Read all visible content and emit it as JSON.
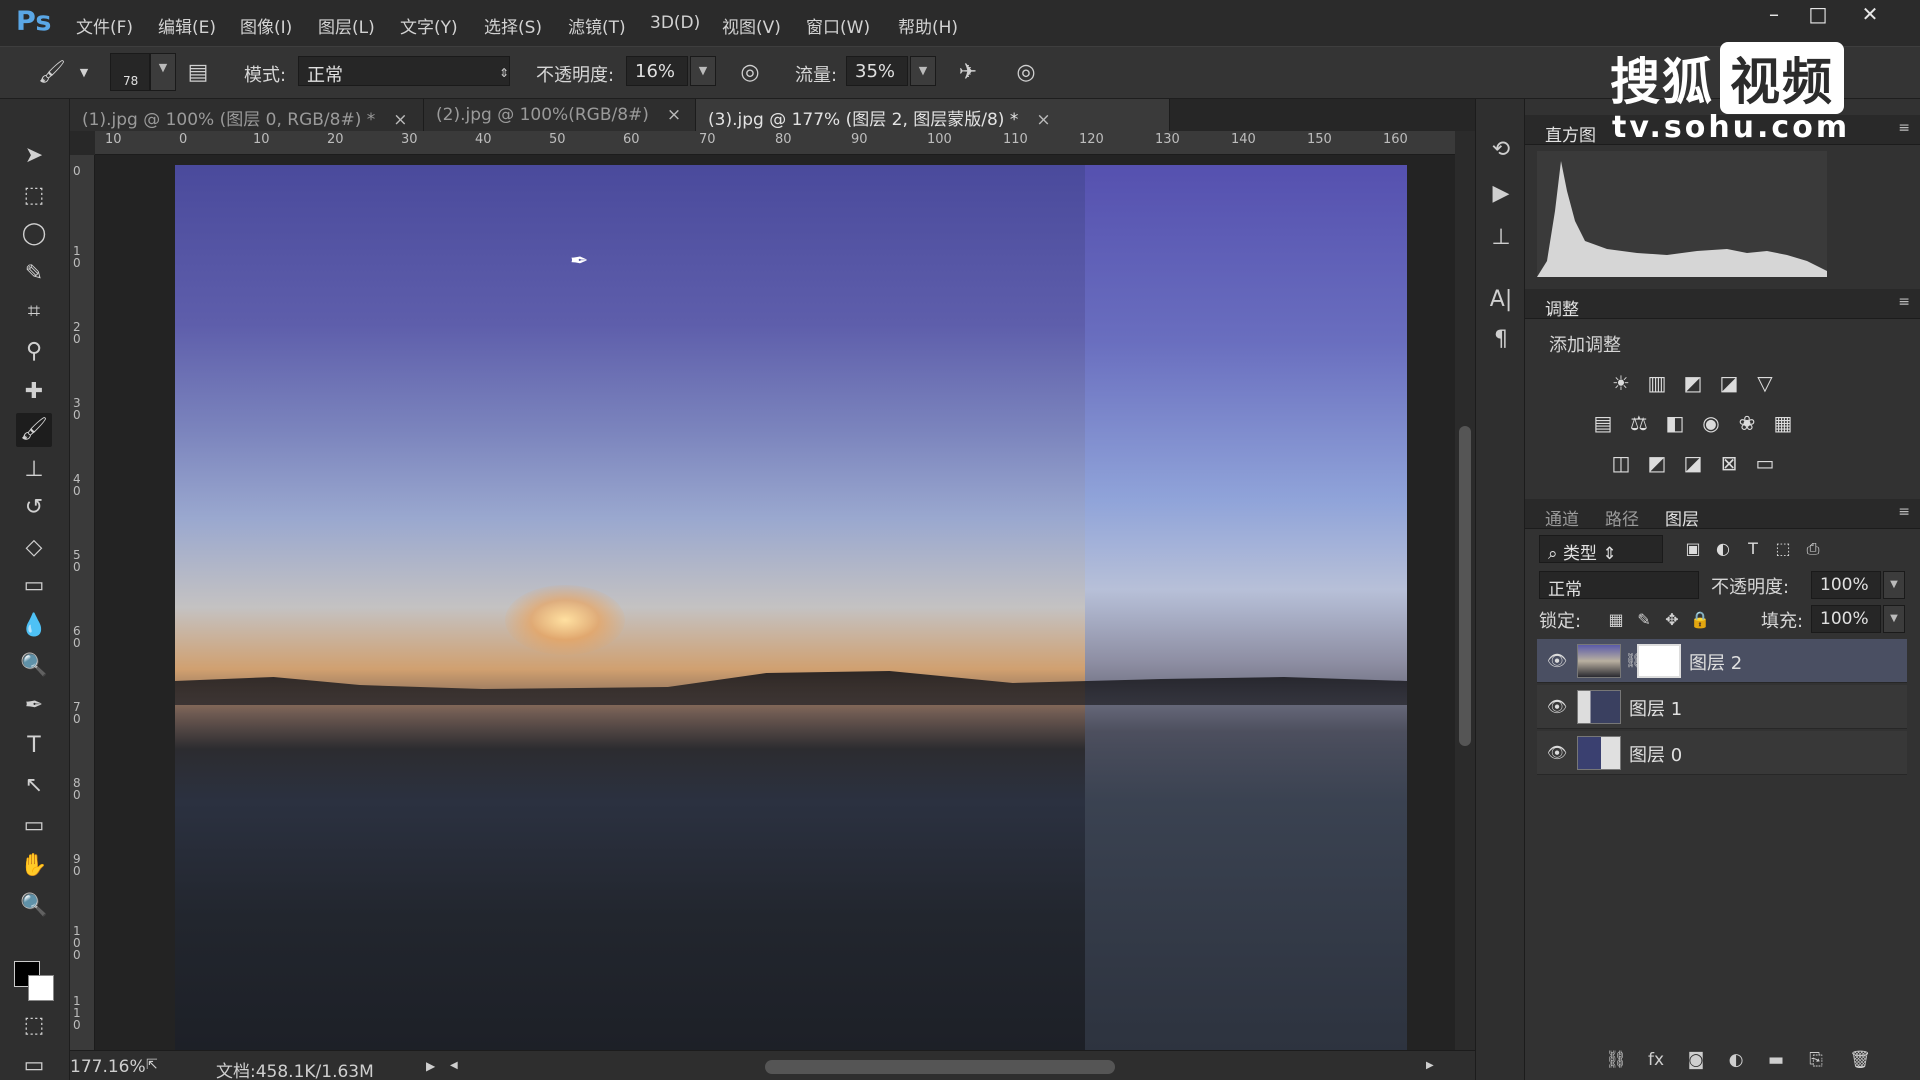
{
  "app": {
    "logo": "Ps"
  },
  "menu": [
    "文件(F)",
    "编辑(E)",
    "图像(I)",
    "图层(L)",
    "文字(Y)",
    "选择(S)",
    "滤镜(T)",
    "3D(D)",
    "视图(V)",
    "窗口(W)",
    "帮助(H)"
  ],
  "window_controls": [
    "–",
    "□",
    "✕"
  ],
  "options": {
    "brush_size": "78",
    "mode_label": "模式:",
    "mode_value": "正常",
    "opacity_label": "不透明度:",
    "opacity_value": "16%",
    "flow_label": "流量:",
    "flow_value": "35%"
  },
  "tabs": [
    {
      "label": "(1).jpg @ 100% (图层 0, RGB/8#) *",
      "active": false
    },
    {
      "label": "(2).jpg @ 100%(RGB/8#)",
      "active": false
    },
    {
      "label": "(3).jpg @ 177% (图层 2, 图层蒙版/8) *",
      "active": true
    }
  ],
  "tab_close": "×",
  "ruler_top": [
    "10",
    "0",
    "10",
    "20",
    "30",
    "40",
    "50",
    "60",
    "70",
    "80",
    "90",
    "100",
    "110",
    "120",
    "130",
    "140",
    "150",
    "160"
  ],
  "ruler_left": [
    "0",
    "10",
    "20",
    "30",
    "40",
    "50",
    "60",
    "70",
    "80",
    "90",
    "100",
    "110"
  ],
  "status": {
    "zoom": "177.16%",
    "doc": "文档:458.1K/1.63M"
  },
  "panels": {
    "histogram_tab": "直方图",
    "adjust_tab": "调整",
    "adjust_title": "添加调整",
    "layers_tabs": [
      "通道",
      "路径",
      "图层"
    ],
    "filter_kind": "类型",
    "blend_mode": "正常",
    "opacity_label": "不透明度:",
    "opacity_value": "100%",
    "lock_label": "锁定:",
    "fill_label": "填充:",
    "fill_value": "100%"
  },
  "layers": [
    {
      "name": "图层 2",
      "selected": true,
      "has_mask": true
    },
    {
      "name": "图层 1",
      "selected": false,
      "has_mask": false
    },
    {
      "name": "图层 0",
      "selected": false,
      "has_mask": false
    }
  ],
  "watermark": {
    "cn_left": "搜狐",
    "cn_box": "视频",
    "url": "tv.sohu.com"
  },
  "colors": {
    "accent": "#5aa7e6",
    "selected_layer": "#4a4f62",
    "panel_bg": "#323232"
  }
}
